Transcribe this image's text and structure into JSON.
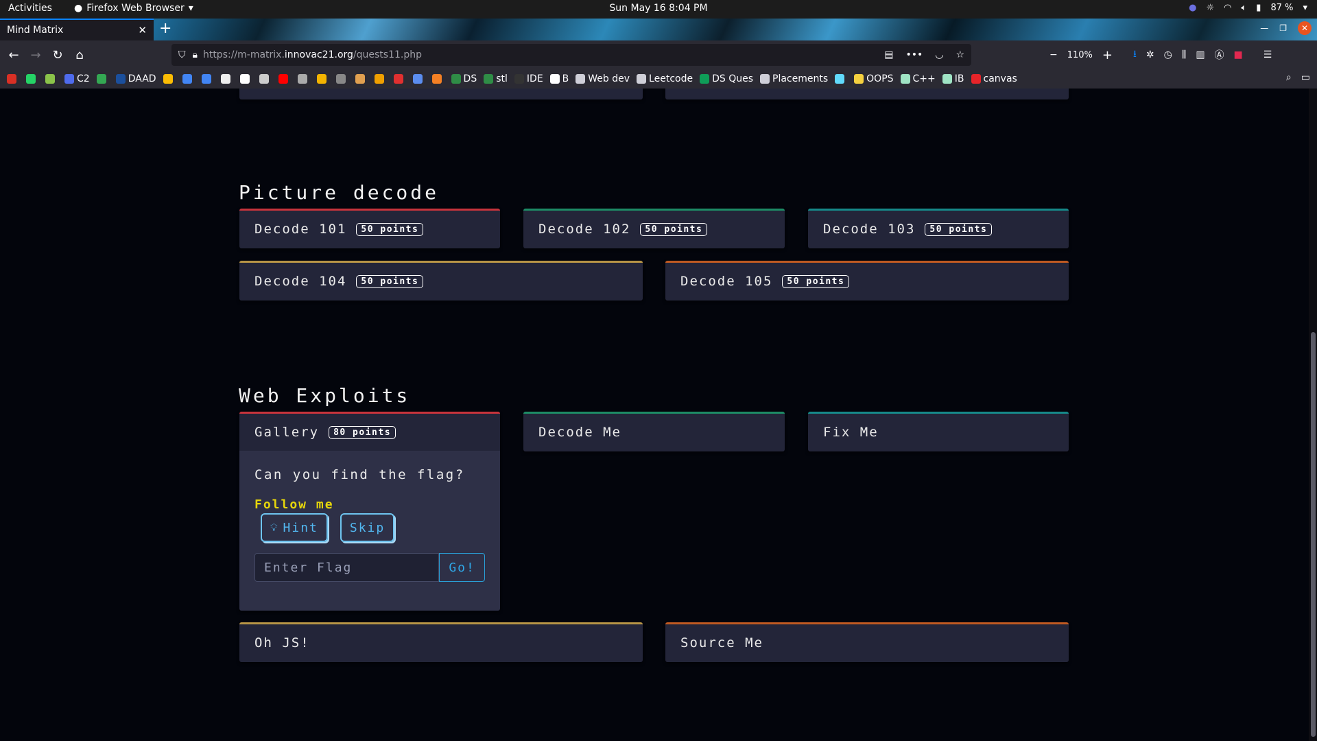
{
  "system": {
    "activities": "Activities",
    "app_name": "Firefox Web Browser",
    "clock": "Sun May 16  8:04 PM",
    "battery": "87 %"
  },
  "browser": {
    "tab_title": "Mind Matrix",
    "url_prefix": "https://m-matrix.",
    "url_domain": "innovac21.org",
    "url_path": "/quests11.php",
    "zoom": "110%",
    "bookmarks": [
      {
        "label": "",
        "color": "#d93025"
      },
      {
        "label": "",
        "color": "#25d366"
      },
      {
        "label": "",
        "color": "#8bc34a"
      },
      {
        "label": "C2",
        "color": "#4f6bed"
      },
      {
        "label": "",
        "color": "#34a853"
      },
      {
        "label": "DAAD",
        "color": "#1b4f9c"
      },
      {
        "label": "",
        "color": "#fbbc04"
      },
      {
        "label": "",
        "color": "#4285f4"
      },
      {
        "label": "",
        "color": "#4285f4"
      },
      {
        "label": "",
        "color": "#eeeeee"
      },
      {
        "label": "",
        "color": "#ffffff"
      },
      {
        "label": "",
        "color": "#cccccc"
      },
      {
        "label": "",
        "color": "#ff0000"
      },
      {
        "label": "",
        "color": "#aaaaaa"
      },
      {
        "label": "",
        "color": "#f4b400"
      },
      {
        "label": "",
        "color": "#888888"
      },
      {
        "label": "",
        "color": "#e0a050"
      },
      {
        "label": "",
        "color": "#f0a000"
      },
      {
        "label": "",
        "color": "#e03030"
      },
      {
        "label": "",
        "color": "#5b8def"
      },
      {
        "label": "",
        "color": "#f48024"
      },
      {
        "label": "DS",
        "color": "#2f8d46"
      },
      {
        "label": "stl",
        "color": "#2f8d46"
      },
      {
        "label": "IDE",
        "color": "#333333"
      },
      {
        "label": "B",
        "color": "#ffffff"
      },
      {
        "label": "Web dev",
        "color": "#cfcfd8"
      },
      {
        "label": "Leetcode",
        "color": "#cfcfd8"
      },
      {
        "label": "DS Ques",
        "color": "#0f9d58"
      },
      {
        "label": "Placements",
        "color": "#cfcfd8"
      },
      {
        "label": "",
        "color": "#61dafb"
      },
      {
        "label": "OOPS",
        "color": "#f4d03f"
      },
      {
        "label": "C++",
        "color": "#9fe3c4"
      },
      {
        "label": "IB",
        "color": "#9fe3c4"
      },
      {
        "label": "canvas",
        "color": "#e72429"
      }
    ]
  },
  "page": {
    "section_picture": "Picture decode",
    "picture_cards": [
      {
        "title": "Decode 101",
        "points": "50 points"
      },
      {
        "title": "Decode 102",
        "points": "50 points"
      },
      {
        "title": "Decode 103",
        "points": "50 points"
      },
      {
        "title": "Decode 104",
        "points": "50 points"
      },
      {
        "title": "Decode 105",
        "points": "50 points"
      }
    ],
    "section_web": "Web Exploits",
    "web_cards": [
      {
        "title": "Gallery",
        "points": "80 points"
      },
      {
        "title": "Decode Me"
      },
      {
        "title": "Fix Me"
      },
      {
        "title": "Oh JS!"
      },
      {
        "title": "Source Me"
      }
    ],
    "gallery": {
      "question": "Can you find the flag?",
      "link": "Follow me",
      "hint_label": "Hint",
      "skip_label": "Skip",
      "flag_placeholder": "Enter Flag",
      "go_label": "Go!"
    }
  }
}
